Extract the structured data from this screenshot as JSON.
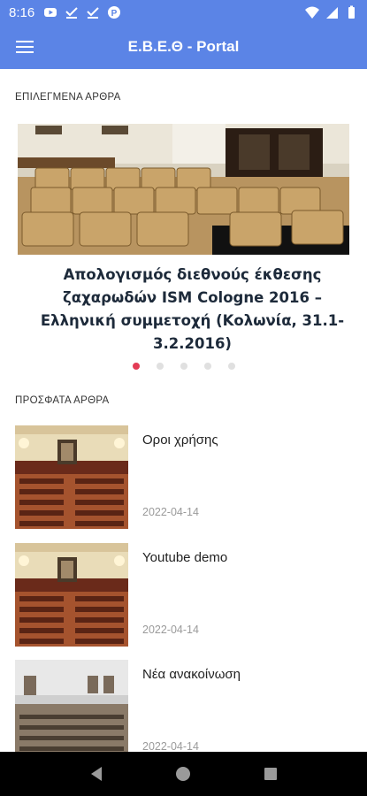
{
  "status_bar": {
    "time": "8:16",
    "left_icons": [
      "youtube-icon",
      "check-icon",
      "check-icon",
      "pocket-icon"
    ],
    "right_icons": [
      "wifi-icon",
      "signal-icon",
      "battery-icon"
    ]
  },
  "app_bar": {
    "title": "Ε.Β.Ε.Θ - Portal",
    "menu_icon": "hamburger-icon",
    "color": "#5b84e6"
  },
  "featured": {
    "section_title": "ΕΠΙΛΕΓΜΕΝΑ ΑΡΘΡΑ",
    "article_title": "Απολογισμός διεθνούς έκθεσης ζαχαρωδών ISM Cologne 2016 – Ελληνική συμμετοχή (Κολωνία, 31.1-3.2.2016)",
    "pager": {
      "count": 5,
      "active_index": 0,
      "active_color": "#e33c55"
    }
  },
  "recent": {
    "section_title": "ΠΡΟΣΦΑΤΑ ΑΡΘΡΑ",
    "articles": [
      {
        "title": "Οροι χρήσης",
        "date": "2022-04-14"
      },
      {
        "title": "Youtube demo",
        "date": "2022-04-14"
      },
      {
        "title": "Νέα ανακοίνωση",
        "date": "2022-04-14"
      }
    ]
  },
  "nav_bar": {
    "buttons": [
      "back-icon",
      "home-icon",
      "recents-icon"
    ]
  }
}
